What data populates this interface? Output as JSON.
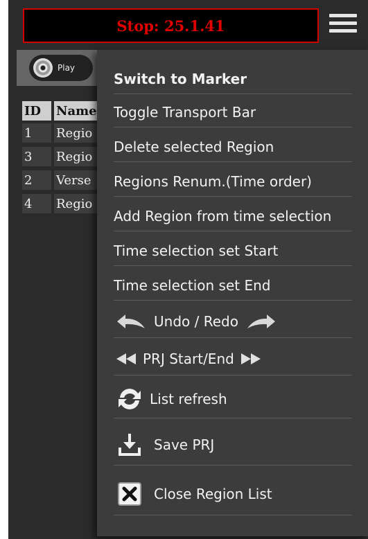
{
  "status": {
    "text": "Stop: 25.1.41",
    "color": "#e00000"
  },
  "toolbar": {
    "play_label": "Play"
  },
  "table": {
    "headers": [
      "ID",
      "Name"
    ],
    "rows": [
      {
        "id": "1",
        "name": "Regio"
      },
      {
        "id": "3",
        "name": "Regio"
      },
      {
        "id": "2",
        "name": "Verse"
      },
      {
        "id": "4",
        "name": "Regio"
      }
    ]
  },
  "menu": {
    "switch_marker": "Switch to Marker",
    "toggle_transport": "Toggle Transport Bar",
    "delete_region": "Delete selected Region",
    "renum": "Regions Renum.(Time order)",
    "add_region": "Add Region from time selection",
    "ts_start": "Time selection set Start",
    "ts_end": "Time selection set End",
    "undo_redo": "Undo / Redo",
    "prj_start_end": "PRJ Start/End",
    "list_refresh": "List refresh",
    "save_prj": "Save PRJ",
    "close_list": "Close Region List"
  }
}
